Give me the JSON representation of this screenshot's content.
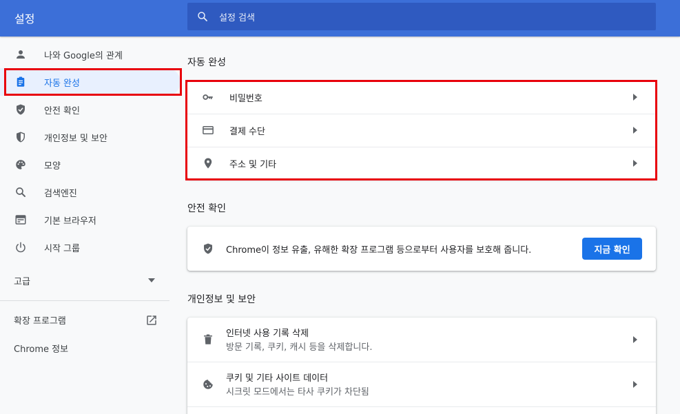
{
  "header": {
    "title": "설정",
    "search_placeholder": "설정 검색"
  },
  "sidebar": {
    "items": [
      {
        "label": "나와 Google의 관계",
        "icon": "person-icon"
      },
      {
        "label": "자동 완성",
        "icon": "clipboard-icon",
        "active": true
      },
      {
        "label": "안전 확인",
        "icon": "shield-check-icon"
      },
      {
        "label": "개인정보 및 보안",
        "icon": "shield-half-icon"
      },
      {
        "label": "모양",
        "icon": "palette-icon"
      },
      {
        "label": "검색엔진",
        "icon": "search-icon"
      },
      {
        "label": "기본 브라우저",
        "icon": "browser-window-icon"
      },
      {
        "label": "시작 그룹",
        "icon": "power-icon"
      }
    ],
    "advanced": "고급",
    "extensions": "확장 프로그램",
    "about": "Chrome 정보"
  },
  "autofill": {
    "title": "자동 완성",
    "rows": [
      {
        "label": "비밀번호",
        "icon": "key-icon"
      },
      {
        "label": "결제 수단",
        "icon": "credit-card-icon"
      },
      {
        "label": "주소 및 기타",
        "icon": "location-pin-icon"
      }
    ]
  },
  "safety": {
    "title": "안전 확인",
    "text": "Chrome이 정보 유출, 유해한 확장 프로그램 등으로부터 사용자를 보호해 줍니다.",
    "button": "지금 확인"
  },
  "privacy": {
    "title": "개인정보 및 보안",
    "rows": [
      {
        "label": "인터넷 사용 기록 삭제",
        "sub": "방문 기록, 쿠키, 캐시 등을 삭제합니다.",
        "icon": "trash-icon"
      },
      {
        "label": "쿠키 및 기타 사이트 데이터",
        "sub": "시크릿 모드에서는 타사 쿠키가 차단됨",
        "icon": "cookie-icon"
      }
    ]
  },
  "colors": {
    "header": "#3c6fd8",
    "accent": "#1a73e8",
    "highlight": "#e8000b"
  }
}
